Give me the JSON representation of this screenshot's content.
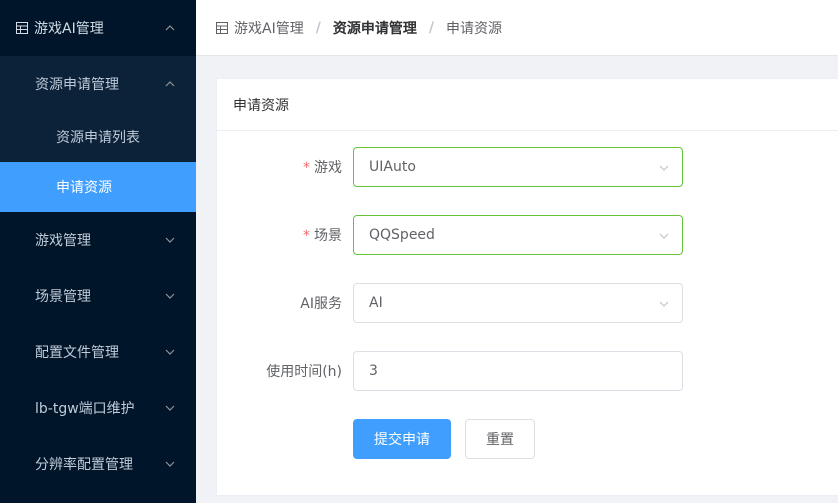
{
  "sidebar": {
    "top": {
      "label": "游戏AI管理",
      "icon": "table-icon",
      "chevron": "chevron-up-icon"
    },
    "group": {
      "label": "资源申请管理",
      "chevron": "chevron-up-icon"
    },
    "leaves": [
      {
        "label": "资源申请列表",
        "active": false
      },
      {
        "label": "申请资源",
        "active": true
      }
    ],
    "items": [
      {
        "label": "游戏管理",
        "chevron": "chevron-down-icon"
      },
      {
        "label": "场景管理",
        "chevron": "chevron-down-icon"
      },
      {
        "label": "配置文件管理",
        "chevron": "chevron-down-icon"
      },
      {
        "label": "lb-tgw端口维护",
        "chevron": "chevron-down-icon"
      },
      {
        "label": "分辨率配置管理",
        "chevron": "chevron-down-icon"
      }
    ]
  },
  "breadcrumb": {
    "icon": "table-icon",
    "items": [
      "游戏AI管理",
      "资源申请管理",
      "申请资源"
    ],
    "separator": "/"
  },
  "card": {
    "title": "申请资源"
  },
  "form": {
    "game": {
      "label": "游戏",
      "required": true,
      "value": "UIAuto"
    },
    "scene": {
      "label": "场景",
      "required": true,
      "value": "QQSpeed"
    },
    "ai_service": {
      "label": "AI服务",
      "required": false,
      "value": "AI"
    },
    "duration": {
      "label": "使用时间(h)",
      "required": false,
      "value": "3"
    },
    "submit_label": "提交申请",
    "reset_label": "重置"
  },
  "colors": {
    "sidebar_bg": "#001529",
    "submenu_bg": "#0b2239",
    "active_bg": "#409eff",
    "valid_border": "#67c23a",
    "required_mark": "#f56c6c"
  }
}
